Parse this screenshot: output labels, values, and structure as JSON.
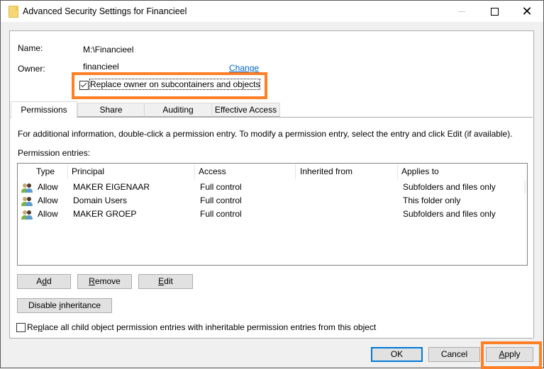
{
  "window": {
    "title": "Advanced Security Settings for Financieel",
    "icon": "folder-icon",
    "controls": {
      "minimize": "—",
      "maximize": "□",
      "close": "✕"
    }
  },
  "header": {
    "name_label": "Name:",
    "name_value": "M:\\Financieel",
    "owner_label": "Owner:",
    "owner_value": "financieel",
    "change_link": "Change",
    "replace_owner_label": "Replace owner on subcontainers and objects",
    "replace_owner_checked": true
  },
  "tabs": [
    {
      "label": "Permissions",
      "active": true
    },
    {
      "label": "Share",
      "active": false
    },
    {
      "label": "Auditing",
      "active": false
    },
    {
      "label": "Effective Access",
      "active": false
    }
  ],
  "permissions": {
    "info_text": "For additional information, double-click a permission entry. To modify a permission entry, select the entry and click Edit (if available).",
    "entries_label": "Permission entries:",
    "columns": [
      "Type",
      "Principal",
      "Access",
      "Inherited from",
      "Applies to"
    ],
    "rows": [
      {
        "icon": "users-icon",
        "type": "Allow",
        "principal": "MAKER EIGENAAR",
        "access": "Full control",
        "inherited_from": "",
        "applies_to": "Subfolders and files only"
      },
      {
        "icon": "users-icon",
        "type": "Allow",
        "principal": "Domain Users",
        "access": "Full control",
        "inherited_from": "",
        "applies_to": "This folder only"
      },
      {
        "icon": "users-icon",
        "type": "Allow",
        "principal": "MAKER GROEP",
        "access": "Full control",
        "inherited_from": "",
        "applies_to": "Subfolders and files only"
      }
    ],
    "buttons": {
      "add": {
        "pre": "A",
        "ul": "d",
        "post": "d"
      },
      "remove": {
        "pre": "",
        "ul": "R",
        "post": "emove"
      },
      "edit": {
        "pre": "",
        "ul": "E",
        "post": "dit"
      },
      "disable_inheritance": {
        "pre": "Disable ",
        "ul": "i",
        "post": "nheritance"
      }
    },
    "replace_child": {
      "pre": "Re",
      "ul": "p",
      "post": "lace all child object permission entries with inheritable permission entries from this object",
      "checked": false
    }
  },
  "footer": {
    "ok": "OK",
    "cancel": "Cancel",
    "apply": {
      "ul": "A",
      "post": "pply"
    }
  },
  "highlight_color": "#ff7f27",
  "link_color": "#0066cc"
}
